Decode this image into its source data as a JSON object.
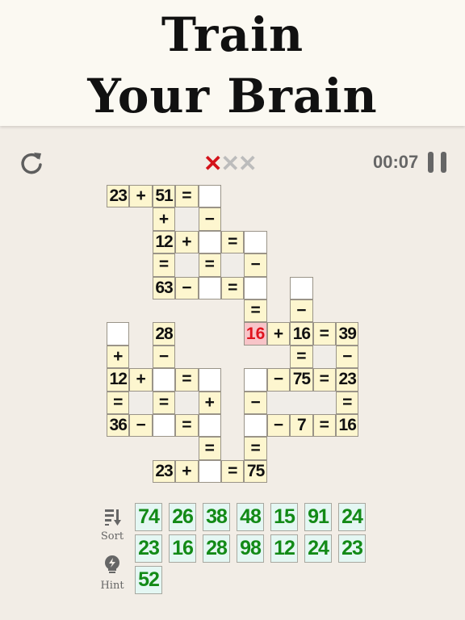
{
  "banner": {
    "line1": "Train",
    "line2": "Your Brain"
  },
  "status": {
    "strikes_used": 1,
    "strikes_total": 3,
    "strike_glyph": "✕",
    "strike_color": "#d4121a",
    "strike_off_color": "#bcbcbc",
    "timer": "00:07"
  },
  "grid": {
    "cells": [
      [
        0,
        0,
        "n",
        "23"
      ],
      [
        0,
        1,
        "o",
        "+"
      ],
      [
        0,
        2,
        "n",
        "51"
      ],
      [
        0,
        3,
        "o",
        "="
      ],
      [
        0,
        4,
        "b",
        ""
      ],
      [
        1,
        2,
        "o",
        "+"
      ],
      [
        1,
        3,
        "g",
        ""
      ],
      [
        1,
        4,
        "o",
        "−"
      ],
      [
        2,
        2,
        "n",
        "12"
      ],
      [
        2,
        3,
        "o",
        "+"
      ],
      [
        2,
        4,
        "b",
        ""
      ],
      [
        2,
        5,
        "o",
        "="
      ],
      [
        2,
        6,
        "b",
        ""
      ],
      [
        3,
        2,
        "o",
        "="
      ],
      [
        3,
        3,
        "g",
        ""
      ],
      [
        3,
        4,
        "o",
        "="
      ],
      [
        3,
        5,
        "g",
        ""
      ],
      [
        3,
        6,
        "o",
        "−"
      ],
      [
        4,
        2,
        "n",
        "63"
      ],
      [
        4,
        3,
        "o",
        "−"
      ],
      [
        4,
        4,
        "b",
        ""
      ],
      [
        4,
        5,
        "o",
        "="
      ],
      [
        4,
        6,
        "b",
        ""
      ],
      [
        4,
        8,
        "b",
        ""
      ],
      [
        5,
        6,
        "o",
        "="
      ],
      [
        5,
        8,
        "o",
        "−"
      ],
      [
        6,
        0,
        "b",
        ""
      ],
      [
        6,
        2,
        "n",
        "28"
      ],
      [
        6,
        6,
        "r",
        "16"
      ],
      [
        6,
        7,
        "o",
        "+"
      ],
      [
        6,
        8,
        "n",
        "16"
      ],
      [
        6,
        9,
        "o",
        "="
      ],
      [
        6,
        10,
        "n",
        "39"
      ],
      [
        7,
        0,
        "o",
        "+"
      ],
      [
        7,
        2,
        "o",
        "−"
      ],
      [
        7,
        8,
        "o",
        "="
      ],
      [
        7,
        9,
        "g",
        ""
      ],
      [
        7,
        10,
        "o",
        "−"
      ],
      [
        8,
        0,
        "n",
        "12"
      ],
      [
        8,
        1,
        "o",
        "+"
      ],
      [
        8,
        2,
        "b",
        ""
      ],
      [
        8,
        3,
        "o",
        "="
      ],
      [
        8,
        4,
        "b",
        ""
      ],
      [
        8,
        6,
        "b",
        ""
      ],
      [
        8,
        7,
        "o",
        "−"
      ],
      [
        8,
        8,
        "n",
        "75"
      ],
      [
        8,
        9,
        "o",
        "="
      ],
      [
        8,
        10,
        "n",
        "23"
      ],
      [
        9,
        0,
        "o",
        "="
      ],
      [
        9,
        1,
        "g",
        ""
      ],
      [
        9,
        2,
        "o",
        "="
      ],
      [
        9,
        3,
        "g",
        ""
      ],
      [
        9,
        4,
        "o",
        "+"
      ],
      [
        9,
        6,
        "o",
        "−"
      ],
      [
        9,
        7,
        "g",
        ""
      ],
      [
        9,
        8,
        "g",
        ""
      ],
      [
        9,
        9,
        "g",
        ""
      ],
      [
        9,
        10,
        "o",
        "="
      ],
      [
        10,
        0,
        "n",
        "36"
      ],
      [
        10,
        1,
        "o",
        "−"
      ],
      [
        10,
        2,
        "b",
        ""
      ],
      [
        10,
        3,
        "o",
        "="
      ],
      [
        10,
        4,
        "b",
        ""
      ],
      [
        10,
        6,
        "b",
        ""
      ],
      [
        10,
        7,
        "o",
        "−"
      ],
      [
        10,
        8,
        "n",
        "7"
      ],
      [
        10,
        9,
        "o",
        "="
      ],
      [
        10,
        10,
        "n",
        "16"
      ],
      [
        11,
        4,
        "o",
        "="
      ],
      [
        11,
        6,
        "o",
        "="
      ],
      [
        12,
        2,
        "n",
        "23"
      ],
      [
        12,
        3,
        "o",
        "+"
      ],
      [
        12,
        4,
        "b",
        ""
      ],
      [
        12,
        5,
        "o",
        "="
      ],
      [
        12,
        6,
        "n",
        "75"
      ]
    ]
  },
  "tiles": [
    [
      "74",
      "26",
      "38",
      "48",
      "15",
      "91",
      "24"
    ],
    [
      "23",
      "16",
      "28",
      "98",
      "12",
      "24",
      "23"
    ],
    [
      "52"
    ]
  ],
  "tools": {
    "sort_label": "Sort",
    "hint_label": "Hint"
  }
}
